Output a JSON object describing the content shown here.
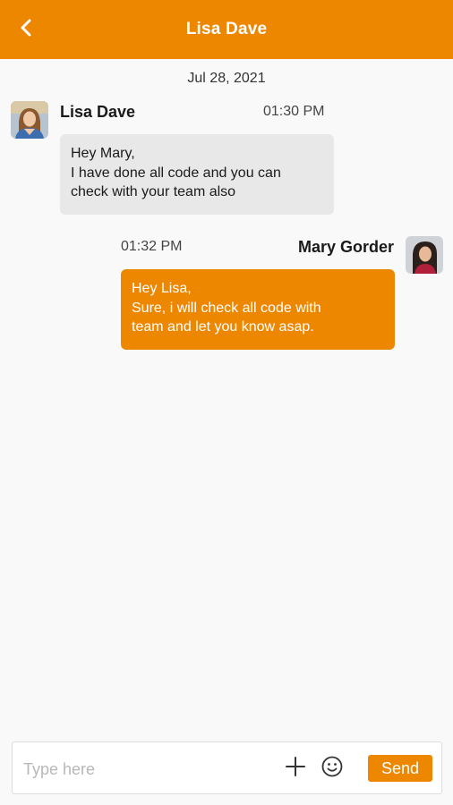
{
  "header": {
    "title": "Lisa Dave",
    "back_icon": "chevron-left-icon"
  },
  "chat": {
    "date": "Jul 28, 2021",
    "messages": [
      {
        "sender": "Lisa Dave",
        "time": "01:30 PM",
        "direction": "incoming",
        "lines": [
          "Hey Mary,",
          "I have done all code and you can",
          "check with your team also"
        ]
      },
      {
        "sender": "Mary Gorder",
        "time": "01:32 PM",
        "direction": "outgoing",
        "lines": [
          "Hey Lisa,",
          "Sure, i will check all code with",
          "team and let you know asap."
        ]
      }
    ]
  },
  "composer": {
    "placeholder": "Type here",
    "value": "",
    "add_icon": "plus-icon",
    "emoji_icon": "smiley-icon",
    "send_label": "Send"
  },
  "colors": {
    "accent": "#ee8700",
    "incoming_bubble": "#e8e8e8",
    "background": "#f9f9f9"
  }
}
